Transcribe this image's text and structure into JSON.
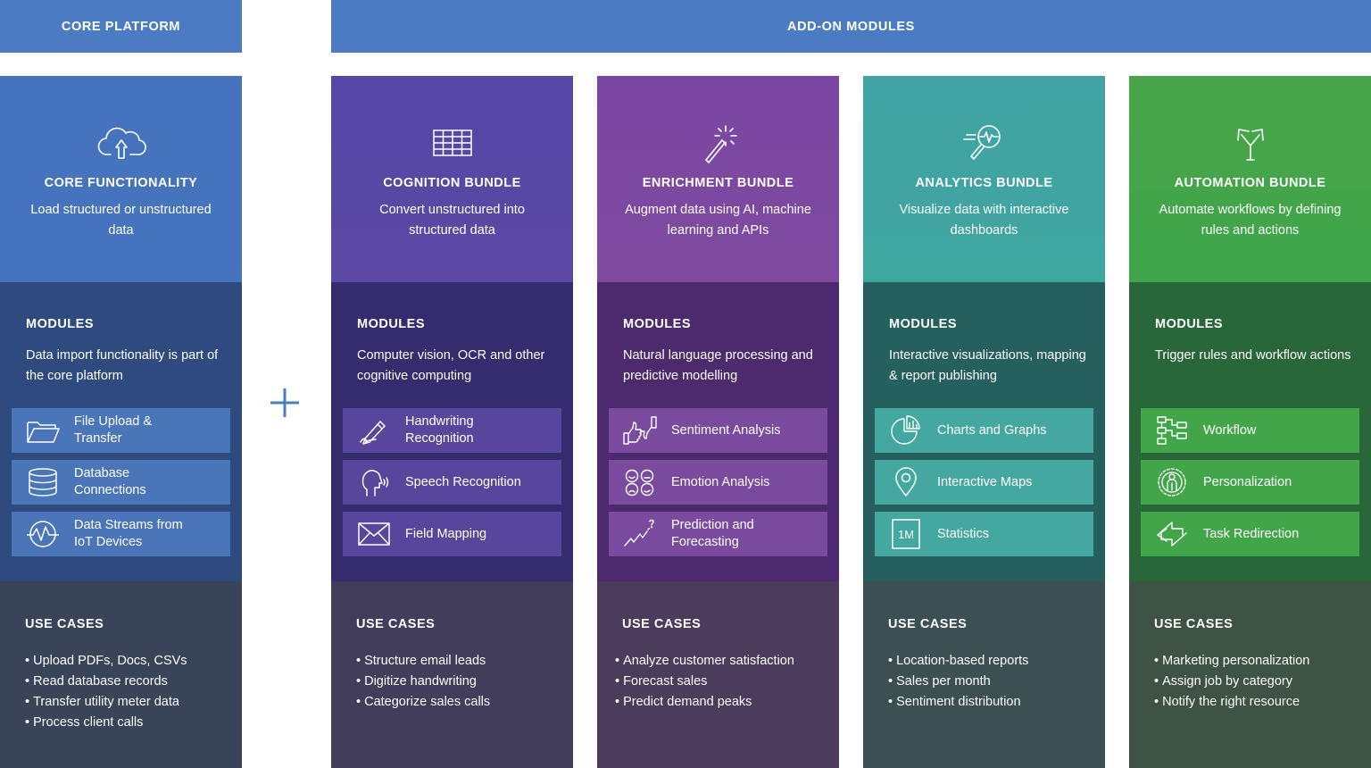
{
  "banners": {
    "core": "CORE PLATFORM",
    "addon": "ADD-ON MODULES"
  },
  "colors": {
    "banner": "#4b7bc2",
    "core": "#4673bd",
    "cognition": "#5547a8",
    "enrichment": "#7a46a2",
    "analytics": "#41a3a4",
    "automation": "#4aa54a",
    "plus": "#4b7bc2"
  },
  "columns": [
    {
      "icon": "cloud-upload-icon",
      "title": "CORE FUNCTIONALITY",
      "description": "Load structured or unstructured data",
      "modules_heading": "MODULES",
      "modules_description": "Data import functionality is part of the core platform",
      "modules": [
        {
          "icon": "folder-icon",
          "label": "File Upload &\nTransfer"
        },
        {
          "icon": "database-icon",
          "label": "Database\nConnections"
        },
        {
          "icon": "data-stream-icon",
          "label": "Data Streams from\nIoT Devices"
        }
      ],
      "use_cases_heading": "USE CASES",
      "use_cases": [
        "Upload PDFs, Docs, CSVs",
        "Read database records",
        "Transfer utility meter data",
        "Process client calls"
      ]
    },
    {
      "icon": "grid-table-icon",
      "title": "COGNITION BUNDLE",
      "description": "Convert unstructured into structured data",
      "modules_heading": "MODULES",
      "modules_description": "Computer vision, OCR and other cognitive computing",
      "modules": [
        {
          "icon": "pen-icon",
          "label": "Handwriting\nRecognition"
        },
        {
          "icon": "speaking-head-icon",
          "label": "Speech Recognition"
        },
        {
          "icon": "envelope-icon",
          "label": "Field Mapping"
        }
      ],
      "use_cases_heading": "USE CASES",
      "use_cases": [
        "Structure email leads",
        "Digitize handwriting",
        "Categorize sales calls"
      ]
    },
    {
      "icon": "magic-wand-icon",
      "title": "ENRICHMENT BUNDLE",
      "description": "Augment data using AI, machine learning and APIs",
      "modules_heading": "MODULES",
      "modules_description": "Natural language processing and predictive modelling",
      "modules": [
        {
          "icon": "thumbs-icon",
          "label": "Sentiment Analysis"
        },
        {
          "icon": "faces-icon",
          "label": "Emotion Analysis"
        },
        {
          "icon": "trend-question-icon",
          "label": "Prediction and\nForecasting"
        }
      ],
      "use_cases_heading": "USE CASES",
      "use_cases": [
        "Analyze customer satisfaction",
        "Forecast sales",
        "Predict demand peaks"
      ]
    },
    {
      "icon": "magnifier-pulse-icon",
      "title": "ANALYTICS BUNDLE",
      "description": "Visualize data with interactive dashboards",
      "modules_heading": "MODULES",
      "modules_description": "Interactive visualizations, mapping & report publishing",
      "modules": [
        {
          "icon": "pie-bar-chart-icon",
          "label": "Charts and Graphs"
        },
        {
          "icon": "map-pin-icon",
          "label": "Interactive Maps"
        },
        {
          "icon": "statistics-1m-icon",
          "label": "Statistics",
          "badge": "1M"
        }
      ],
      "use_cases_heading": "USE CASES",
      "use_cases": [
        "Location-based reports",
        "Sales per month",
        "Sentiment distribution"
      ]
    },
    {
      "icon": "split-arrows-icon",
      "title": "AUTOMATION BUNDLE",
      "description": "Automate workflows by defining rules and actions",
      "modules_heading": "MODULES",
      "modules_description": "Trigger rules and workflow actions",
      "modules": [
        {
          "icon": "workflow-icon",
          "label": "Workflow"
        },
        {
          "icon": "person-target-icon",
          "label": "Personalization"
        },
        {
          "icon": "redirect-arrows-icon",
          "label": "Task Redirection"
        }
      ],
      "use_cases_heading": "USE CASES",
      "use_cases": [
        "Marketing personalization",
        "Assign job by category",
        "Notify the right resource"
      ]
    }
  ]
}
